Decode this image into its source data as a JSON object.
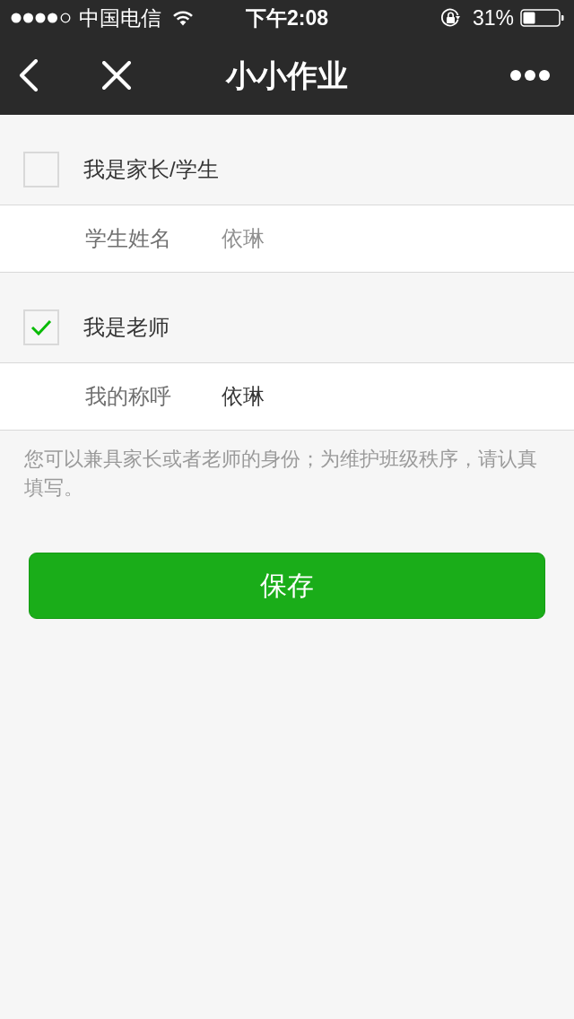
{
  "status_bar": {
    "carrier": "中国电信",
    "time": "下午2:08",
    "battery": "31%"
  },
  "nav_bar": {
    "title": "小小作业"
  },
  "roles": [
    {
      "label": "我是家长/学生",
      "checked": false,
      "field": {
        "label": "学生姓名",
        "placeholder": "依琳"
      }
    },
    {
      "label": "我是老师",
      "checked": true,
      "field": {
        "label": "我的称呼",
        "value": "依琳"
      }
    }
  ],
  "note": "您可以兼具家长或者老师的身份；为维护班级秩序，请认真填写。",
  "save_button": {
    "label": "保存"
  }
}
